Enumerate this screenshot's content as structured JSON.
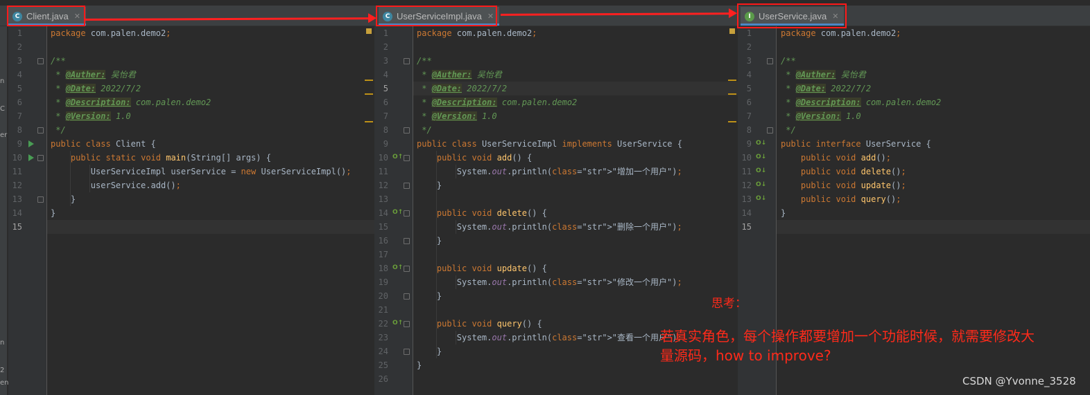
{
  "panes": [
    {
      "file": "Client.java",
      "icon": "C",
      "line_numbers": [
        "1",
        "2",
        "3",
        "4",
        "5",
        "6",
        "7",
        "8",
        "9",
        "10",
        "11",
        "12",
        "13",
        "14",
        "15"
      ],
      "current_line": 15,
      "code": [
        "package com.palen.demo2;",
        "",
        "/**",
        " * @Auther: 吴怡君",
        " * @Date: 2022/7/2",
        " * @Description: com.palen.demo2",
        " * @Version: 1.0",
        " */",
        "public class Client {",
        "    public static void main(String[] args) {",
        "        UserServiceImpl userService = new UserServiceImpl();",
        "        userService.add();",
        "    }",
        "}",
        ""
      ]
    },
    {
      "file": "UserServiceImpl.java",
      "icon": "C",
      "line_numbers": [
        "1",
        "2",
        "3",
        "4",
        "5",
        "6",
        "7",
        "8",
        "9",
        "10",
        "11",
        "12",
        "13",
        "14",
        "15",
        "16",
        "17",
        "18",
        "19",
        "20",
        "21",
        "22",
        "23",
        "24",
        "25",
        "26"
      ],
      "current_line": 5,
      "code": [
        "package com.palen.demo2;",
        "",
        "/**",
        " * @Auther: 吴怡君",
        " * @Date: 2022/7/2",
        " * @Description: com.palen.demo2",
        " * @Version: 1.0",
        " */",
        "public class UserServiceImpl implements UserService {",
        "    public void add() {",
        "        System.out.println(\"增加一个用户\");",
        "    }",
        "",
        "    public void delete() {",
        "        System.out.println(\"删除一个用户\");",
        "    }",
        "",
        "    public void update() {",
        "        System.out.println(\"修改一个用户\");",
        "    }",
        "",
        "    public void query() {",
        "        System.out.println(\"查看一个用户\");",
        "    }",
        "}",
        ""
      ]
    },
    {
      "file": "UserService.java",
      "icon": "I",
      "line_numbers": [
        "1",
        "2",
        "3",
        "4",
        "5",
        "6",
        "7",
        "8",
        "9",
        "10",
        "11",
        "12",
        "13",
        "14",
        "15"
      ],
      "current_line": 15,
      "code": [
        "package com.palen.demo2;",
        "",
        "/**",
        " * @Auther: 吴怡君",
        " * @Date: 2022/7/2",
        " * @Description: com.palen.demo2",
        " * @Version: 1.0",
        " */",
        "public interface UserService {",
        "    public void add();",
        "    public void delete();",
        "    public void update();",
        "    public void query();",
        "}",
        ""
      ]
    }
  ],
  "annotation": {
    "heading": "思考：",
    "line1": "若真实角色，每个操作都要增加一个功能时候，就需要修改大",
    "line2": "量源码，how to improve?"
  },
  "watermark": "CSDN @Yvonne_3528",
  "colors": {
    "editor_bg": "#2b2b2b",
    "keyword": "#cc7832",
    "string": "#6a8759",
    "comment": "#629755",
    "annotation_red": "#ff2020",
    "class_icon": "#3e86a0",
    "interface_icon": "#5b9b4a"
  }
}
